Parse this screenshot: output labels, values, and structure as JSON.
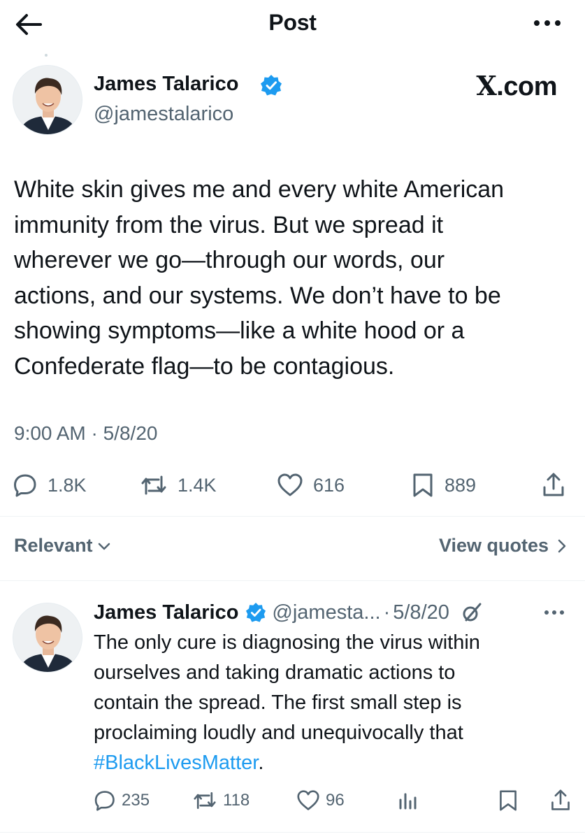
{
  "header": {
    "title": "Post",
    "back_icon": "arrow-left-icon",
    "more_icon": "ellipsis-icon"
  },
  "post": {
    "author_name": "James Talarico",
    "author_handle": "@jamestalarico",
    "verified_icon": "verified-badge-icon",
    "source_mark": "X.com",
    "text_lines": [
      "White skin gives me and every white American",
      "immunity from the virus. But we spread it",
      "wherever we go—through our words, our",
      "actions, and our systems. We don’t have to be",
      "showing symptoms—like a white hood or a",
      "Confederate flag—to be contagious."
    ],
    "timestamp": "9:00 AM · 5/8/20",
    "actions": {
      "replies": "1.8K",
      "reposts": "1.4K",
      "likes": "616",
      "bookmarks": "889"
    }
  },
  "sort": {
    "label": "Relevant",
    "view_quotes": "View quotes"
  },
  "reply": {
    "author_name": "James Talarico",
    "author_handle": "@jamesta...",
    "separator": "·",
    "date": "5/8/20",
    "text_lines": [
      "The only cure is diagnosing the virus within",
      "ourselves and taking dramatic actions to",
      "contain the spread. The first small step is",
      "proclaiming loudly and unequivocally that"
    ],
    "hashtag": "#BlackLivesMatter",
    "hashtag_suffix": ".",
    "actions": {
      "replies": "235",
      "reposts": "118",
      "likes": "96"
    }
  },
  "colors": {
    "text": "#0f1419",
    "secondary": "#536471",
    "accent": "#1d9bf0",
    "divider": "#eff3f4"
  }
}
